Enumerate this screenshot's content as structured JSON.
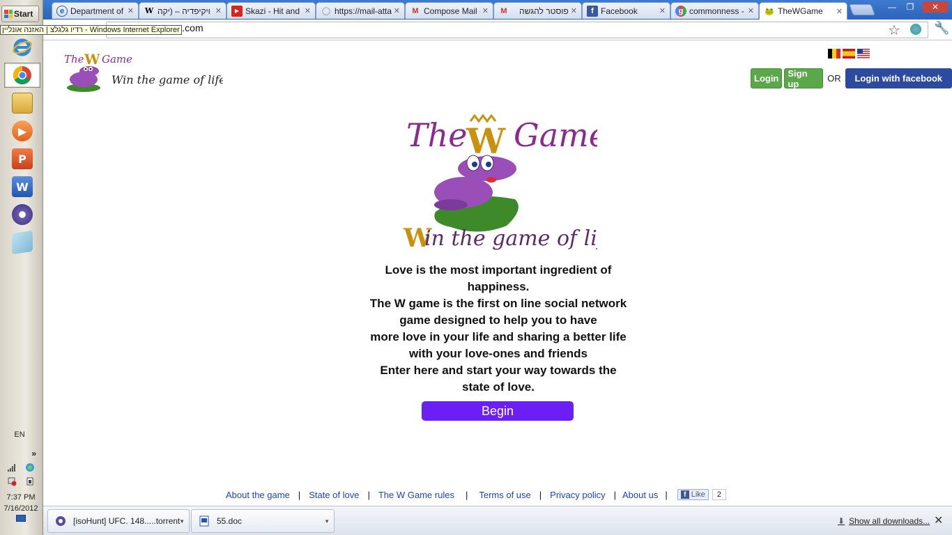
{
  "taskbar": {
    "start_label": "Start",
    "apps": [
      {
        "name": "internet-explorer-icon"
      },
      {
        "name": "chrome-icon"
      },
      {
        "name": "file-explorer-icon"
      },
      {
        "name": "media-player-icon"
      },
      {
        "name": "powerpoint-icon",
        "glyph": "P"
      },
      {
        "name": "word-icon",
        "glyph": "W"
      },
      {
        "name": "bittorrent-icon"
      },
      {
        "name": "notepad-icon"
      }
    ],
    "language": "EN",
    "expand_glyph": "»",
    "clock_time": "7:37 PM",
    "clock_date": "7/16/2012"
  },
  "tooltip": "רדיו גלגלצ | האזנה אונליין - Windows Internet Explorer",
  "tabs": [
    {
      "title": "Department of C",
      "favicon": "e",
      "close": "✕"
    },
    {
      "title": "ויקיפדיה – (יקה",
      "favicon": "W",
      "close": "✕"
    },
    {
      "title": "Skazi - Hit and R",
      "favicon": "▶",
      "close": "✕"
    },
    {
      "title": "https://mail-atta",
      "favicon": "◯",
      "close": "✕"
    },
    {
      "title": "Compose Mail - r",
      "favicon": "M",
      "close": "✕"
    },
    {
      "title": "פוסטר להגשה",
      "favicon": "M",
      "close": "✕"
    },
    {
      "title": "Facebook",
      "favicon": "f",
      "close": "✕"
    },
    {
      "title": "commonness - G",
      "favicon": "g",
      "close": "✕"
    },
    {
      "title": "TheWGame",
      "favicon": "🐸",
      "close": "✕"
    }
  ],
  "window_controls": {
    "minimize": "—",
    "restore": "❐",
    "close": "✕"
  },
  "address_bar": {
    "url": "ne.appspot.com"
  },
  "site": {
    "small_logo_top": "The W Game",
    "small_logo_sub": "Win the game of life",
    "flags": [
      "belgium-flag",
      "spain-flag",
      "usa-flag"
    ],
    "login_label": "Login",
    "signup_label": "Sign up",
    "or_label": "OR",
    "facebook_login_label": "Login with facebook",
    "big_logo_title_1": "The",
    "big_logo_title_w": "W",
    "big_logo_title_2": "Game",
    "big_logo_sub_w": "W",
    "big_logo_sub": "in the game of life",
    "tagline_lines": [
      "Love is the most important ingredient of",
      "happiness.",
      "The W game is the first on line social network",
      "game designed to help you to have",
      "more love in your life and sharing a better life",
      "with your love-ones and friends",
      "Enter here and start your way towards the",
      "state of love."
    ],
    "begin_label": "Begin",
    "footer_links": [
      "About the game",
      "State of love",
      "The W Game rules",
      "Terms of use",
      "Privacy policy",
      "About us"
    ],
    "footer_sep": "|",
    "like_label": "Like",
    "like_count": "2"
  },
  "downloads": {
    "items": [
      {
        "label": "[isoHunt] UFC. 148.....torrent",
        "icon": "torrent-file-icon"
      },
      {
        "label": "55.doc",
        "icon": "doc-file-icon"
      }
    ],
    "show_all_label": "Show all downloads...",
    "close_glyph": "✕"
  },
  "colors": {
    "begin_button": "#6b1ff5",
    "green_button": "#5aa84a",
    "facebook_button": "#2c4aa0",
    "logo_purple": "#8b2a8f",
    "logo_gold": "#c9920e",
    "link_blue": "#1a44c8"
  }
}
